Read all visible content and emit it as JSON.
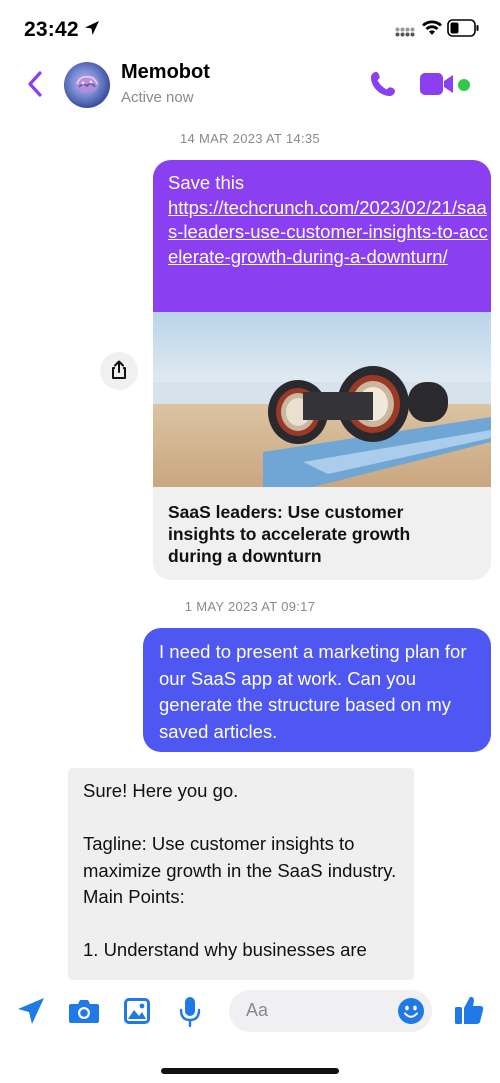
{
  "status_bar": {
    "time": "23:42",
    "icons": [
      "location-arrow-icon",
      "cellular-signal-icon",
      "wifi-icon",
      "battery-icon"
    ]
  },
  "header": {
    "back_icon": "chevron-left-icon",
    "contact_name": "Memobot",
    "contact_status": "Active now",
    "actions": [
      "phone-icon",
      "video-camera-icon"
    ],
    "online_indicator": "online"
  },
  "colors": {
    "accent": "#8a3ff0",
    "outgoing_bubble": "#4f57f2",
    "incoming_bubble": "#efefef",
    "online_dot": "#31c94a",
    "icon_blue": "#1f7ae8"
  },
  "messages": [
    {
      "timestamp": "14 MAR 2023 AT 14:35",
      "sender": "me",
      "text": "Save this",
      "link_url": "https://techcrunch.com/2023/02/21/saas-leaders-use-customer-insights-to-accelerate-growth-during-a-downturn/",
      "link_preview_title": "SaaS leaders: Use customer insights to accelerate growth during a downturn",
      "link_preview_image": "binoculars-on-beach-image"
    },
    {
      "timestamp": "1 MAY 2023 AT 09:17",
      "sender": "me",
      "text": "I need to present a marketing plan for our SaaS app at work. Can you generate the structure based on my saved articles."
    },
    {
      "sender": "Memobot",
      "text": "Sure! Here you go.\n\nTagline: Use customer insights to maximize growth in the SaaS industry.\nMain Points:\n\n1. Understand why businesses are"
    }
  ],
  "composer": {
    "icons": [
      "send-location-icon",
      "camera-icon",
      "image-icon",
      "microphone-icon"
    ],
    "placeholder": "Aa",
    "emoji_icon": "smiley-icon",
    "like_icon": "thumbs-up-icon"
  }
}
